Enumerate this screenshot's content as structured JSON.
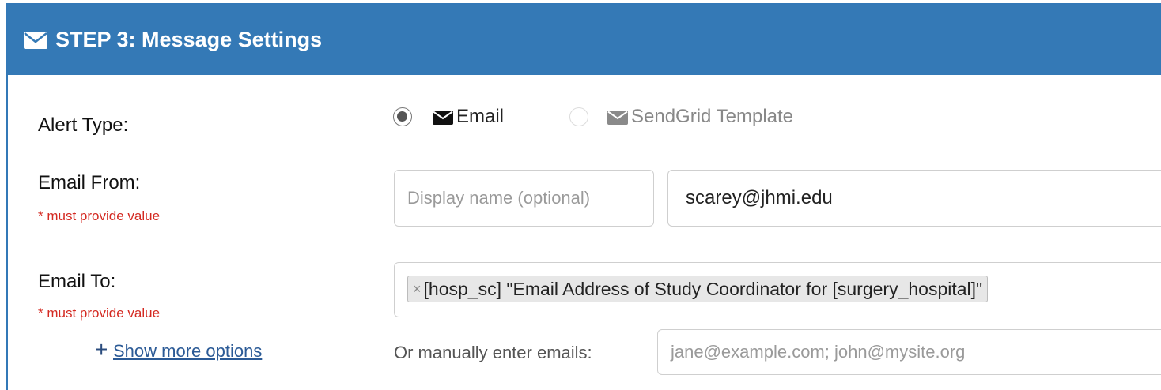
{
  "header": {
    "title": "STEP 3: Message Settings",
    "icon": "envelope-icon"
  },
  "alert_type": {
    "label": "Alert Type:",
    "options": [
      {
        "label": "Email",
        "selected": true,
        "enabled": true
      },
      {
        "label": "SendGrid Template",
        "selected": false,
        "enabled": false
      }
    ]
  },
  "email_from": {
    "label": "Email From:",
    "required_note": "* must provide value",
    "display_name_placeholder": "Display name (optional)",
    "address_value": "scarey@jhmi.edu"
  },
  "email_to": {
    "label": "Email To:",
    "required_note": "* must provide value",
    "chip_remove": "×",
    "chip_text": "[hosp_sc] \"Email Address of Study Coordinator for [surgery_hospital]\"",
    "show_more_plus": "+",
    "show_more_label": "Show more options",
    "manual_label": "Or manually enter emails:",
    "manual_placeholder": "jane@example.com; john@mysite.org"
  },
  "colors": {
    "header_bg": "#3479b6",
    "required_text": "#d42a22",
    "link": "#2b5a96"
  }
}
